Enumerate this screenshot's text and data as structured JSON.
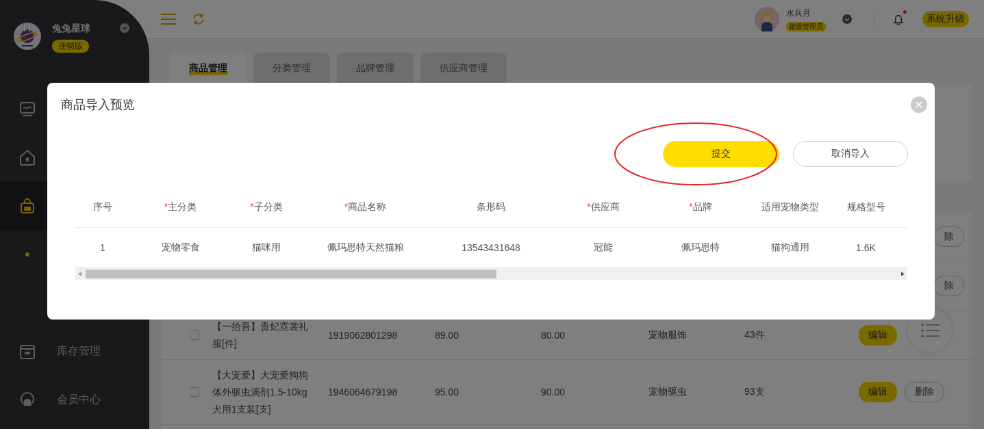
{
  "sidebar": {
    "brand": "兔兔星球",
    "edition": "连锁版",
    "items": [
      {
        "kind": "monitor",
        "selected": false
      },
      {
        "kind": "home",
        "selected": false
      },
      {
        "kind": "bag",
        "selected": true
      },
      {
        "kind": "dot",
        "selected": false
      },
      {
        "kind": "box",
        "label": "库存管理",
        "selected": false
      },
      {
        "kind": "member",
        "label": "会员中心",
        "selected": false
      }
    ]
  },
  "topbar": {
    "user_name": "水兵月",
    "role": "超级管理员",
    "notification_unread": true,
    "upgrade": "系统升级"
  },
  "tabs": [
    {
      "label": "商品管理",
      "selected": true
    },
    {
      "label": "分类管理",
      "selected": false
    },
    {
      "label": "品牌管理",
      "selected": false
    },
    {
      "label": "供应商管理",
      "selected": false
    }
  ],
  "products": [
    {
      "delete": "除"
    },
    {
      "delete": "除"
    },
    {
      "checked": false,
      "name": "【一拾吾】贵妃霓裳礼服[件]",
      "barcode": "1919062801298",
      "price": "89.00",
      "member_price": "80.00",
      "category": "宠物服饰",
      "stock": "43件",
      "edit": "编辑"
    },
    {
      "checked": false,
      "name": "【大宠爱】大宠爱狗狗体外驱虫滴剂1.5-10kg犬用1支装[支]",
      "barcode": "1946064679198",
      "price": "95.00",
      "member_price": "90.00",
      "category": "宠物驱虫",
      "stock": "93支",
      "edit": "编辑",
      "delete": "删除"
    }
  ],
  "dialog": {
    "title": "商品导入预览",
    "submit": "提交",
    "cancel": "取消导入",
    "submit_circled": true,
    "columns": [
      {
        "label": "序号"
      },
      {
        "required_mark": "*",
        "label": "主分类"
      },
      {
        "required_mark": "*",
        "label": "子分类"
      },
      {
        "required_mark": "*",
        "label": "商品名称"
      },
      {
        "label": "条形码"
      },
      {
        "required_mark": "*",
        "label": "供应商"
      },
      {
        "required_mark": "*",
        "label": "品牌"
      },
      {
        "label": "适用宠物类型"
      },
      {
        "label": "规格型号"
      }
    ],
    "rows": [
      [
        "1",
        "宠物零食",
        "猫咪用",
        "佩玛思特天然猫粮",
        "13543431648",
        "冠能",
        "佩玛思特",
        "猫狗通用",
        "1.6K"
      ]
    ]
  }
}
